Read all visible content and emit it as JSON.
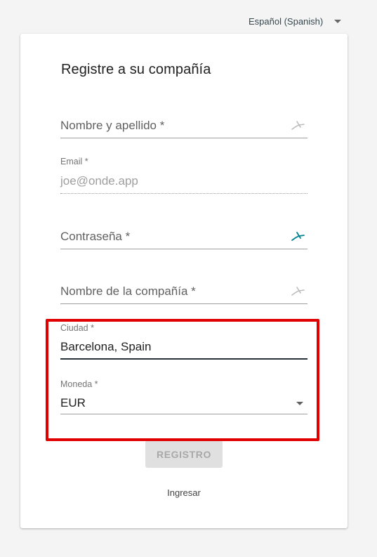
{
  "language_selector": {
    "label": "Español (Spanish)"
  },
  "form": {
    "title": "Registre a su compañía",
    "full_name": {
      "placeholder": "Nombre y apellido *"
    },
    "email": {
      "label": "Email *",
      "value": "joe@onde.app"
    },
    "password": {
      "placeholder": "Contraseña *"
    },
    "company": {
      "placeholder": "Nombre de la compañía *"
    },
    "city": {
      "label": "Ciudad *",
      "value": "Barcelona, Spain"
    },
    "currency": {
      "label": "Moneda *",
      "value": "EUR"
    },
    "submit_label": "REGISTRO",
    "login_link": "Ingresar"
  },
  "colors": {
    "accent": "#00838f",
    "highlight_border": "#e00000",
    "disabled_button_bg": "#e0e0e0",
    "disabled_button_text": "#a8a8a8"
  },
  "icons": {
    "password_manager": "key-bird-icon",
    "dropdown": "caret-down-icon"
  }
}
